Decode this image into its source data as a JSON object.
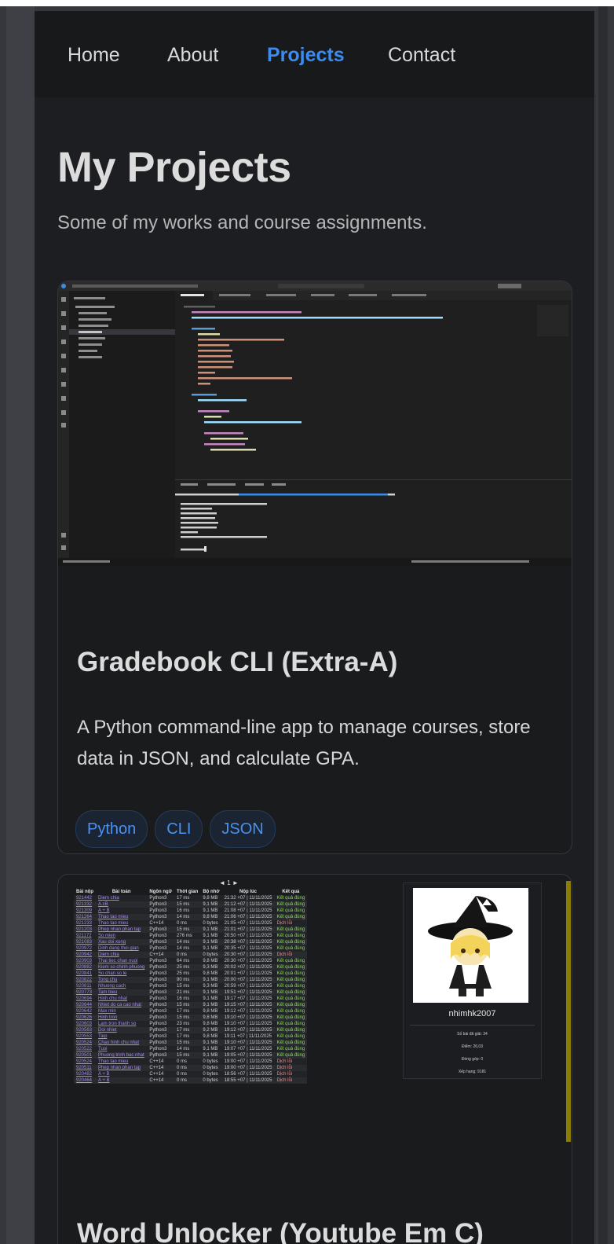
{
  "nav": {
    "items": [
      {
        "label": "Home",
        "active": false
      },
      {
        "label": "About",
        "active": false
      },
      {
        "label": "Projects",
        "active": true
      },
      {
        "label": "Contact",
        "active": false
      }
    ],
    "active_color": "#3b8bf0"
  },
  "header": {
    "title": "My Projects",
    "subtitle": "Some of my works and course assignments."
  },
  "projects": [
    {
      "title": "Gradebook CLI (Extra-A)",
      "description": "A Python command-line app to manage courses, store data in JSON, and calculate GPA.",
      "tags": [
        "Python",
        "CLI",
        "JSON"
      ],
      "screenshot": {
        "kind": "vscode-editor",
        "code_lines": [
          "from storage import load_data",
          "from gradebook import add_course, update_course, delete_course, view_gradebook, calculate_gpa",
          "",
          "def menu():",
          "    print(\"\"\"",
          "===== GRADE GRADEBOOK =====",
          "1. Add course",
          "2. Update course",
          "3. Delete course",
          "4. View gradebook",
          "5. Calculate GPA",
          "6. Exit",
          "===========================",
          "\"\"\")",
          "",
          "def main():",
          "    data = load_data()",
          "",
          "    while True:",
          "        menu()",
          "        choice = input(\"Choose: \").strip()",
          "",
          "        if choice == \"1\":",
          "            add_course(data)",
          "        elif choice == \"2\":",
          "            update_course(data)"
        ],
        "terminal_lines": [
          "===== GRADE GRADEBOOK =====",
          "1. Add course",
          "2. Update course",
          "3. Delete course",
          "4. View gradebook",
          "5. Calculate GPA",
          "6. Exit",
          "===========================",
          "Choose: "
        ]
      }
    },
    {
      "title": "Word Unlocker (Youtube Em C)",
      "screenshot": {
        "kind": "submission-table",
        "pager": "◄ 1 ►",
        "columns": [
          "Bài nộp",
          "Bài toán",
          "Ngôn ngữ",
          "Thời gian",
          "Bộ nhớ",
          "Nộp lúc",
          "Kết quả"
        ],
        "rows": [
          {
            "id": "921442",
            "problem": "Diem chia",
            "lang": "Python3",
            "time": "17 ms",
            "mem": "9,8 MB",
            "at": "21:32 +07 | 11/11/2025",
            "result": "Kết quả đúng",
            "ok": true
          },
          {
            "id": "921332",
            "problem": "A.cB",
            "lang": "Python3",
            "time": "15 ms",
            "mem": "9,1 MB",
            "at": "21:12 +07 | 11/11/2025",
            "result": "Kết quả đúng",
            "ok": true
          },
          {
            "id": "921309",
            "problem": "A + B",
            "lang": "Python3",
            "time": "16 ms",
            "mem": "9,1 MB",
            "at": "21:08 +07 | 11/11/2025",
            "result": "Kết quả đúng",
            "ok": true
          },
          {
            "id": "921264",
            "problem": "Thao tao mieu",
            "lang": "Python3",
            "time": "14 ms",
            "mem": "9,8 MB",
            "at": "21:06 +07 | 11/11/2025",
            "result": "Kết quả đúng",
            "ok": true
          },
          {
            "id": "921233",
            "problem": "Thao tao mieu",
            "lang": "C++14",
            "time": "0 ms",
            "mem": "0 bytes",
            "at": "21:05 +07 | 11/11/2025",
            "result": "Dịch lỗi",
            "ok": false
          },
          {
            "id": "921203",
            "problem": "Phep nhan phan tap",
            "lang": "Python3",
            "time": "15 ms",
            "mem": "9,1 MB",
            "at": "21:01 +07 | 11/11/2025",
            "result": "Kết quả đúng",
            "ok": true
          },
          {
            "id": "921172",
            "problem": "So mien",
            "lang": "Python3",
            "time": "276 ms",
            "mem": "9,1 MB",
            "at": "20:50 +07 | 11/11/2025",
            "result": "Kết quả đúng",
            "ok": true
          },
          {
            "id": "921083",
            "problem": "Xau doi xung",
            "lang": "Python3",
            "time": "14 ms",
            "mem": "9,1 MB",
            "at": "20:38 +07 | 11/11/2025",
            "result": "Kết quả đúng",
            "ok": true
          },
          {
            "id": "920972",
            "problem": "Dinh dang thoi gian",
            "lang": "Python3",
            "time": "14 ms",
            "mem": "9,1 MB",
            "at": "20:35 +07 | 11/11/2025",
            "result": "Kết quả đúng",
            "ok": true
          },
          {
            "id": "920942",
            "problem": "Diem chia",
            "lang": "C++14",
            "time": "0 ms",
            "mem": "0 bytes",
            "at": "20:30 +07 | 11/11/2025",
            "result": "Dịch lỗi",
            "ok": false
          },
          {
            "id": "920903",
            "problem": "Thai tiec chan nuoi",
            "lang": "Python3",
            "time": "64 ms",
            "mem": "9,8 MB",
            "at": "20:30 +07 | 11/11/2025",
            "result": "Kết quả đúng",
            "ok": true
          },
          {
            "id": "920882",
            "problem": "Kiem so chinh phuong",
            "lang": "Python3",
            "time": "25 ms",
            "mem": "9,3 MB",
            "at": "20:02 +07 | 11/11/2025",
            "result": "Kết quả đúng",
            "ok": true
          },
          {
            "id": "920841",
            "problem": "So chan so le",
            "lang": "Python3",
            "time": "25 ms",
            "mem": "9,8 MB",
            "at": "20:01 +07 | 11/11/2025",
            "result": "Kết quả đúng",
            "ok": true
          },
          {
            "id": "920822",
            "problem": "Tong chu",
            "lang": "Python3",
            "time": "90 ms",
            "mem": "9,1 MB",
            "at": "20:00 +07 | 11/11/2025",
            "result": "Kết quả đúng",
            "ok": true
          },
          {
            "id": "920811",
            "problem": "Nhuong cach",
            "lang": "Python3",
            "time": "15 ms",
            "mem": "9,3 MB",
            "at": "20:59 +07 | 11/11/2025",
            "result": "Kết quả đúng",
            "ok": true
          },
          {
            "id": "920773",
            "problem": "Tam bieu",
            "lang": "Python3",
            "time": "21 ms",
            "mem": "9,1 MB",
            "at": "19:51 +07 | 11/11/2025",
            "result": "Kết quả đúng",
            "ok": true
          },
          {
            "id": "920694",
            "problem": "Hinh chu nhat",
            "lang": "Python3",
            "time": "16 ms",
            "mem": "9,1 MB",
            "at": "19:17 +07 | 11/11/2025",
            "result": "Kết quả đúng",
            "ok": true
          },
          {
            "id": "920644",
            "problem": "Nhiet do ca cao nhat",
            "lang": "Python3",
            "time": "15 ms",
            "mem": "9,1 MB",
            "at": "19:15 +07 | 11/11/2025",
            "result": "Kết quả đúng",
            "ok": true
          },
          {
            "id": "920642",
            "problem": "Max min",
            "lang": "Python3",
            "time": "17 ms",
            "mem": "9,8 MB",
            "at": "19:12 +07 | 11/11/2025",
            "result": "Kết quả đúng",
            "ok": true
          },
          {
            "id": "920626",
            "problem": "Hinh tron",
            "lang": "Python3",
            "time": "15 ms",
            "mem": "9,8 MB",
            "at": "19:10 +07 | 11/11/2025",
            "result": "Kết quả đúng",
            "ok": true
          },
          {
            "id": "920603",
            "problem": "Lam tron thanh so",
            "lang": "Python3",
            "time": "23 ms",
            "mem": "9,8 MB",
            "at": "19:10 +07 | 11/11/2025",
            "result": "Kết quả đúng",
            "ok": true
          },
          {
            "id": "920563",
            "problem": "Doi nhiet",
            "lang": "Python3",
            "time": "17 ms",
            "mem": "9,2 MB",
            "at": "19:12 +07 | 11/11/2025",
            "result": "Kết quả đúng",
            "ok": true
          },
          {
            "id": "920553",
            "problem": "Tiep",
            "lang": "Python3",
            "time": "17 ms",
            "mem": "9,8 MB",
            "at": "19:11 +07 | 11/11/2025",
            "result": "Kết quả đúng",
            "ok": true
          },
          {
            "id": "920524",
            "problem": "Chao hinh chu nhat",
            "lang": "Python3",
            "time": "15 ms",
            "mem": "9,1 MB",
            "at": "19:10 +07 | 11/11/2025",
            "result": "Kết quả đúng",
            "ok": true
          },
          {
            "id": "920522",
            "problem": "Tuoi",
            "lang": "Python3",
            "time": "14 ms",
            "mem": "9,1 MB",
            "at": "19:07 +07 | 11/11/2025",
            "result": "Kết quả đúng",
            "ok": true
          },
          {
            "id": "920501",
            "problem": "Phuong trinh bac nhat",
            "lang": "Python3",
            "time": "15 ms",
            "mem": "9,1 MB",
            "at": "19:05 +07 | 11/11/2025",
            "result": "Kết quả đúng",
            "ok": true
          },
          {
            "id": "920524",
            "problem": "Thao tao mieu",
            "lang": "C++14",
            "time": "0 ms",
            "mem": "0 bytes",
            "at": "19:00 +07 | 11/11/2025",
            "result": "Dịch lỗi",
            "ok": false
          },
          {
            "id": "920511",
            "problem": "Phep nhan phan tap",
            "lang": "C++14",
            "time": "0 ms",
            "mem": "0 bytes",
            "at": "19:00 +07 | 11/11/2025",
            "result": "Dịch lỗi",
            "ok": false
          },
          {
            "id": "920482",
            "problem": "A + B",
            "lang": "C++14",
            "time": "0 ms",
            "mem": "0 bytes",
            "at": "18:56 +07 | 11/11/2025",
            "result": "Dịch lỗi",
            "ok": false
          },
          {
            "id": "920464",
            "problem": "A + B",
            "lang": "C++14",
            "time": "0 ms",
            "mem": "0 bytes",
            "at": "18:55 +07 | 11/11/2025",
            "result": "Dịch lỗi",
            "ok": false
          }
        ],
        "profile": {
          "username": "nhimhk2007",
          "stats": [
            "Số bài đã giải: 34",
            "Điểm: 26,03",
            "Đóng góp: 0",
            "Xếp hạng: 9181"
          ]
        }
      }
    }
  ]
}
